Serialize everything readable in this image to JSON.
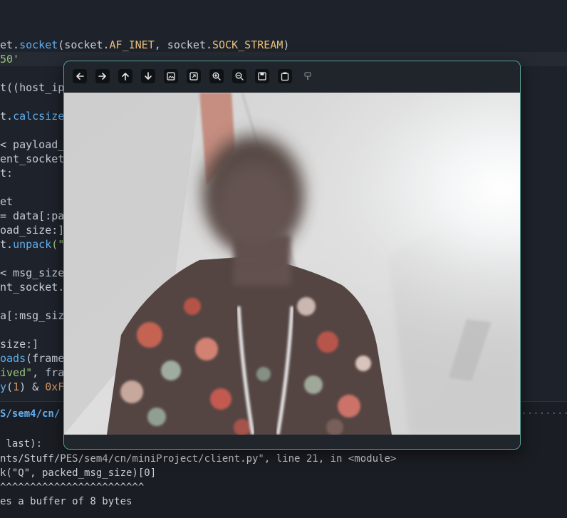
{
  "editor": {
    "lines": [
      [
        [
          "et.",
          "plain"
        ],
        [
          "socket",
          "attr"
        ],
        [
          "(socket.",
          "plain"
        ],
        [
          "AF_INET",
          "const"
        ],
        [
          ", socket.",
          "plain"
        ],
        [
          "SOCK_STREAM",
          "const"
        ],
        [
          ")",
          "plain"
        ]
      ],
      [
        [
          "50'",
          "str"
        ]
      ],
      [],
      [
        [
          "t((host_ip",
          "plain"
        ]
      ],
      [],
      [
        [
          "t.",
          "plain"
        ],
        [
          "calcsize",
          "attr"
        ]
      ],
      [],
      [
        [
          "< payload_",
          "plain"
        ]
      ],
      [
        [
          "ent_socket",
          "plain"
        ]
      ],
      [
        [
          "t:",
          "plain"
        ]
      ],
      [],
      [
        [
          "et",
          "plain"
        ]
      ],
      [
        [
          "= data[:pa",
          "plain"
        ]
      ],
      [
        [
          "oad_size:]",
          "plain"
        ]
      ],
      [
        [
          "t.",
          "plain"
        ],
        [
          "unpack",
          "attr"
        ],
        [
          "(\"",
          "str"
        ]
      ],
      [],
      [
        [
          "< msg_size",
          "plain"
        ]
      ],
      [
        [
          "nt_socket.",
          "plain"
        ]
      ],
      [],
      [
        [
          "a[:msg_siz",
          "plain"
        ]
      ],
      [],
      [
        [
          "size:]",
          "plain"
        ]
      ],
      [
        [
          "oads",
          "attr"
        ],
        [
          "(frame",
          "plain"
        ]
      ],
      [
        [
          "ived\"",
          "str"
        ],
        [
          ", fra",
          "plain"
        ]
      ],
      [
        [
          "y",
          "attr"
        ],
        [
          "(",
          "plain"
        ],
        [
          "1",
          "num"
        ],
        [
          ") & ",
          "plain"
        ],
        [
          "0xF",
          "num"
        ]
      ]
    ]
  },
  "terminal": {
    "prompt_path": "S/sem4/cn/",
    "prompt_dots": "······································",
    "lines": [
      " last):",
      "nts/Stuff/PES/sem4/cn/miniProject/client.py\", line 21, in <module>",
      "k(\"Q\", packed_msg_size)[0]",
      "^^^^^^^^^^^^^^^^^^^^^^^^",
      "es a buffer of 8 bytes"
    ]
  },
  "viewer": {
    "toolbar": [
      {
        "name": "previous-image-button",
        "icon": "arrow-left-icon"
      },
      {
        "name": "next-image-button",
        "icon": "arrow-right-icon"
      },
      {
        "name": "first-image-button",
        "icon": "arrow-up-icon"
      },
      {
        "name": "last-image-button",
        "icon": "arrow-down-icon"
      },
      {
        "name": "fit-to-window-button",
        "icon": "image-icon"
      },
      {
        "name": "original-size-button",
        "icon": "image-resize-icon"
      },
      {
        "name": "zoom-in-button",
        "icon": "zoom-in-icon"
      },
      {
        "name": "zoom-out-button",
        "icon": "zoom-out-icon"
      },
      {
        "name": "save-image-button",
        "icon": "save-icon"
      },
      {
        "name": "image-info-button",
        "icon": "clipboard-icon"
      },
      {
        "name": "print-image-button",
        "icon": "brush-icon",
        "disabled": true
      }
    ]
  },
  "colors": {
    "accent": "#5aa39a",
    "attr": "#61afef",
    "const": "#e5c07b",
    "string": "#98c379",
    "number": "#d19a66"
  }
}
